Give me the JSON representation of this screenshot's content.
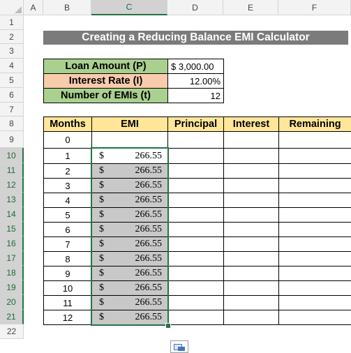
{
  "columns": [
    "A",
    "B",
    "C",
    "D",
    "E",
    "F"
  ],
  "rows": [
    "1",
    "2",
    "3",
    "4",
    "5",
    "6",
    "7",
    "8",
    "9",
    "10",
    "11",
    "12",
    "13",
    "14",
    "15",
    "16",
    "17",
    "18",
    "19",
    "20",
    "21",
    "22"
  ],
  "title": "Creating a Reducing Balance EMI Calculator",
  "inputs": {
    "loan_label": "Loan Amount (P)",
    "loan_value": "$ 3,000.00",
    "rate_label": "Interest Rate (I)",
    "rate_value": "12.00%",
    "emis_label": "Number of EMIs (t)",
    "emis_value": "12"
  },
  "table": {
    "headers": [
      "Months",
      "EMI",
      "Principal",
      "Interest",
      "Remaining"
    ],
    "months": [
      "0",
      "1",
      "2",
      "3",
      "4",
      "5",
      "6",
      "7",
      "8",
      "9",
      "10",
      "11",
      "12"
    ],
    "currency": "$",
    "emi": "266.55"
  },
  "colors": {
    "title_bg": "#7b7b7b",
    "label_green": "#a9d08e",
    "label_peach": "#f8cbad",
    "header_yellow": "#ffe699",
    "selection": "#217346"
  }
}
